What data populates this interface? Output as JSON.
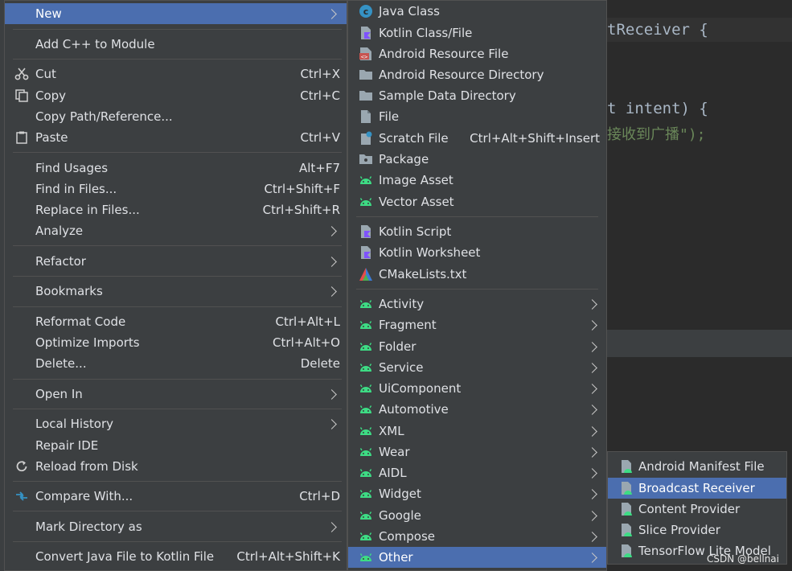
{
  "editor": {
    "line1": "tReceiver {",
    "line2": "t intent) {",
    "line3_str": "接收到广播\");"
  },
  "main_menu": [
    {
      "label": "New",
      "shortcut": "",
      "submenu": true,
      "selected": true
    },
    {
      "label": "Add C++ to Module",
      "shortcut": "",
      "submenu": false
    },
    {
      "label": "Cut",
      "shortcut": "Ctrl+X",
      "icon": "scissors-icon"
    },
    {
      "label": "Copy",
      "shortcut": "Ctrl+C",
      "icon": "copy-icon"
    },
    {
      "label": "Copy Path/Reference...",
      "shortcut": ""
    },
    {
      "label": "Paste",
      "shortcut": "Ctrl+V",
      "icon": "paste-icon"
    },
    {
      "label": "Find Usages",
      "shortcut": "Alt+F7"
    },
    {
      "label": "Find in Files...",
      "shortcut": "Ctrl+Shift+F"
    },
    {
      "label": "Replace in Files...",
      "shortcut": "Ctrl+Shift+R"
    },
    {
      "label": "Analyze",
      "shortcut": "",
      "submenu": true
    },
    {
      "label": "Refactor",
      "shortcut": "",
      "submenu": true
    },
    {
      "label": "Bookmarks",
      "shortcut": "",
      "submenu": true
    },
    {
      "label": "Reformat Code",
      "shortcut": "Ctrl+Alt+L"
    },
    {
      "label": "Optimize Imports",
      "shortcut": "Ctrl+Alt+O"
    },
    {
      "label": "Delete...",
      "shortcut": "Delete"
    },
    {
      "label": "Open In",
      "shortcut": "",
      "submenu": true
    },
    {
      "label": "Local History",
      "shortcut": "",
      "submenu": true
    },
    {
      "label": "Repair IDE",
      "shortcut": ""
    },
    {
      "label": "Reload from Disk",
      "shortcut": "",
      "icon": "reload-icon"
    },
    {
      "label": "Compare With...",
      "shortcut": "Ctrl+D",
      "icon": "compare-icon"
    },
    {
      "label": "Mark Directory as",
      "shortcut": "",
      "submenu": true
    },
    {
      "label": "Convert Java File to Kotlin File",
      "shortcut": "Ctrl+Alt+Shift+K"
    }
  ],
  "new_menu": [
    {
      "label": "Java Class",
      "icon": "java-class-icon"
    },
    {
      "label": "Kotlin Class/File",
      "icon": "kotlin-file-icon"
    },
    {
      "label": "Android Resource File",
      "icon": "resource-file-icon"
    },
    {
      "label": "Android Resource Directory",
      "icon": "folder-icon"
    },
    {
      "label": "Sample Data Directory",
      "icon": "folder-icon"
    },
    {
      "label": "File",
      "icon": "file-icon"
    },
    {
      "label": "Scratch File",
      "shortcut": "Ctrl+Alt+Shift+Insert",
      "icon": "scratch-file-icon"
    },
    {
      "label": "Package",
      "icon": "package-icon"
    },
    {
      "label": "Image Asset",
      "icon": "android-icon"
    },
    {
      "label": "Vector Asset",
      "icon": "android-icon"
    },
    {
      "label": "Kotlin Script",
      "icon": "kotlin-file-icon"
    },
    {
      "label": "Kotlin Worksheet",
      "icon": "kotlin-file-icon"
    },
    {
      "label": "CMakeLists.txt",
      "icon": "cmake-icon"
    },
    {
      "label": "Activity",
      "icon": "android-icon",
      "submenu": true
    },
    {
      "label": "Fragment",
      "icon": "android-icon",
      "submenu": true
    },
    {
      "label": "Folder",
      "icon": "android-icon",
      "submenu": true
    },
    {
      "label": "Service",
      "icon": "android-icon",
      "submenu": true
    },
    {
      "label": "UiComponent",
      "icon": "android-icon",
      "submenu": true
    },
    {
      "label": "Automotive",
      "icon": "android-icon",
      "submenu": true
    },
    {
      "label": "XML",
      "icon": "android-icon",
      "submenu": true
    },
    {
      "label": "Wear",
      "icon": "android-icon",
      "submenu": true
    },
    {
      "label": "AIDL",
      "icon": "android-icon",
      "submenu": true
    },
    {
      "label": "Widget",
      "icon": "android-icon",
      "submenu": true
    },
    {
      "label": "Google",
      "icon": "android-icon",
      "submenu": true
    },
    {
      "label": "Compose",
      "icon": "android-icon",
      "submenu": true
    },
    {
      "label": "Other",
      "icon": "android-icon",
      "submenu": true,
      "selected": true
    }
  ],
  "other_menu": [
    {
      "label": "Android Manifest File",
      "icon": "android-file-icon"
    },
    {
      "label": "Broadcast Receiver",
      "icon": "android-file-icon",
      "selected": true
    },
    {
      "label": "Content Provider",
      "icon": "android-file-icon"
    },
    {
      "label": "Slice Provider",
      "icon": "android-file-icon"
    },
    {
      "label": "TensorFlow Lite Model",
      "icon": "android-file-icon"
    }
  ],
  "watermark": "CSDN @bellnai",
  "colors": {
    "menu_bg": "#3c3f41",
    "selection": "#4b6eaf",
    "android_green": "#3ddc84",
    "editor_bg": "#2b2b2b"
  }
}
